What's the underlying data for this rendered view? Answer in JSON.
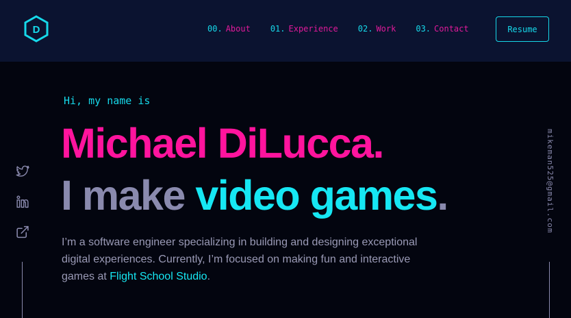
{
  "nav": {
    "logo_letter": "D",
    "links": [
      {
        "num": "00.",
        "label": "About"
      },
      {
        "num": "01.",
        "label": "Experience"
      },
      {
        "num": "02.",
        "label": "Work"
      },
      {
        "num": "03.",
        "label": "Contact"
      }
    ],
    "resume_label": "Resume"
  },
  "hero": {
    "greeting": "Hi, my name is",
    "name": "Michael DiLucca.",
    "tagline_prefix": "I make ",
    "tagline_highlight": "video games",
    "tagline_suffix": ".",
    "bio_text": "I’m a software engineer specializing in building and designing exceptional digital experiences. Currently, I’m focused on making fun and interactive games at ",
    "bio_link": "Flight School Studio",
    "bio_end": "."
  },
  "social": {
    "icons": [
      "twitter-icon",
      "linkedin-icon",
      "external-link-icon"
    ]
  },
  "email": "mikeman525@gmail.com",
  "colors": {
    "background": "#03050f",
    "navbar": "#0b1330",
    "accent_cyan": "#16d9ea",
    "accent_pink": "#ff149d",
    "muted": "#8a8aae"
  }
}
